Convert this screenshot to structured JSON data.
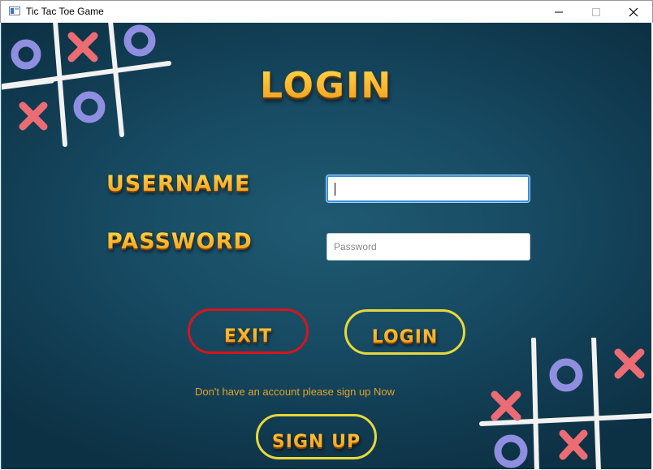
{
  "window": {
    "title": "Tic Tac Toe Game",
    "app_icon": "window-app-icon",
    "controls": [
      "minimize-icon",
      "maximize-icon",
      "close-icon"
    ]
  },
  "login": {
    "heading": "LOGIN",
    "username_label": "USERNAME",
    "username_value": "",
    "password_label": "PASSWORD",
    "password_placeholder": "Password",
    "password_value": ""
  },
  "buttons": {
    "exit": "EXIT",
    "login": "LOGIN",
    "signup": "SIGN UP"
  },
  "signup_hint": "Don't have an account please sign up Now",
  "colors": {
    "background": "#174b63",
    "title_text": "#f6b828",
    "exit_border": "#d8141c",
    "button_border": "#e8d83a",
    "hint_text": "#e0a32a",
    "o_mark": "#8f8ee0",
    "x_mark": "#ec6c74"
  },
  "decorations": [
    "tic-tac-toe-board-icon-top-left",
    "tic-tac-toe-board-icon-bottom-right"
  ]
}
